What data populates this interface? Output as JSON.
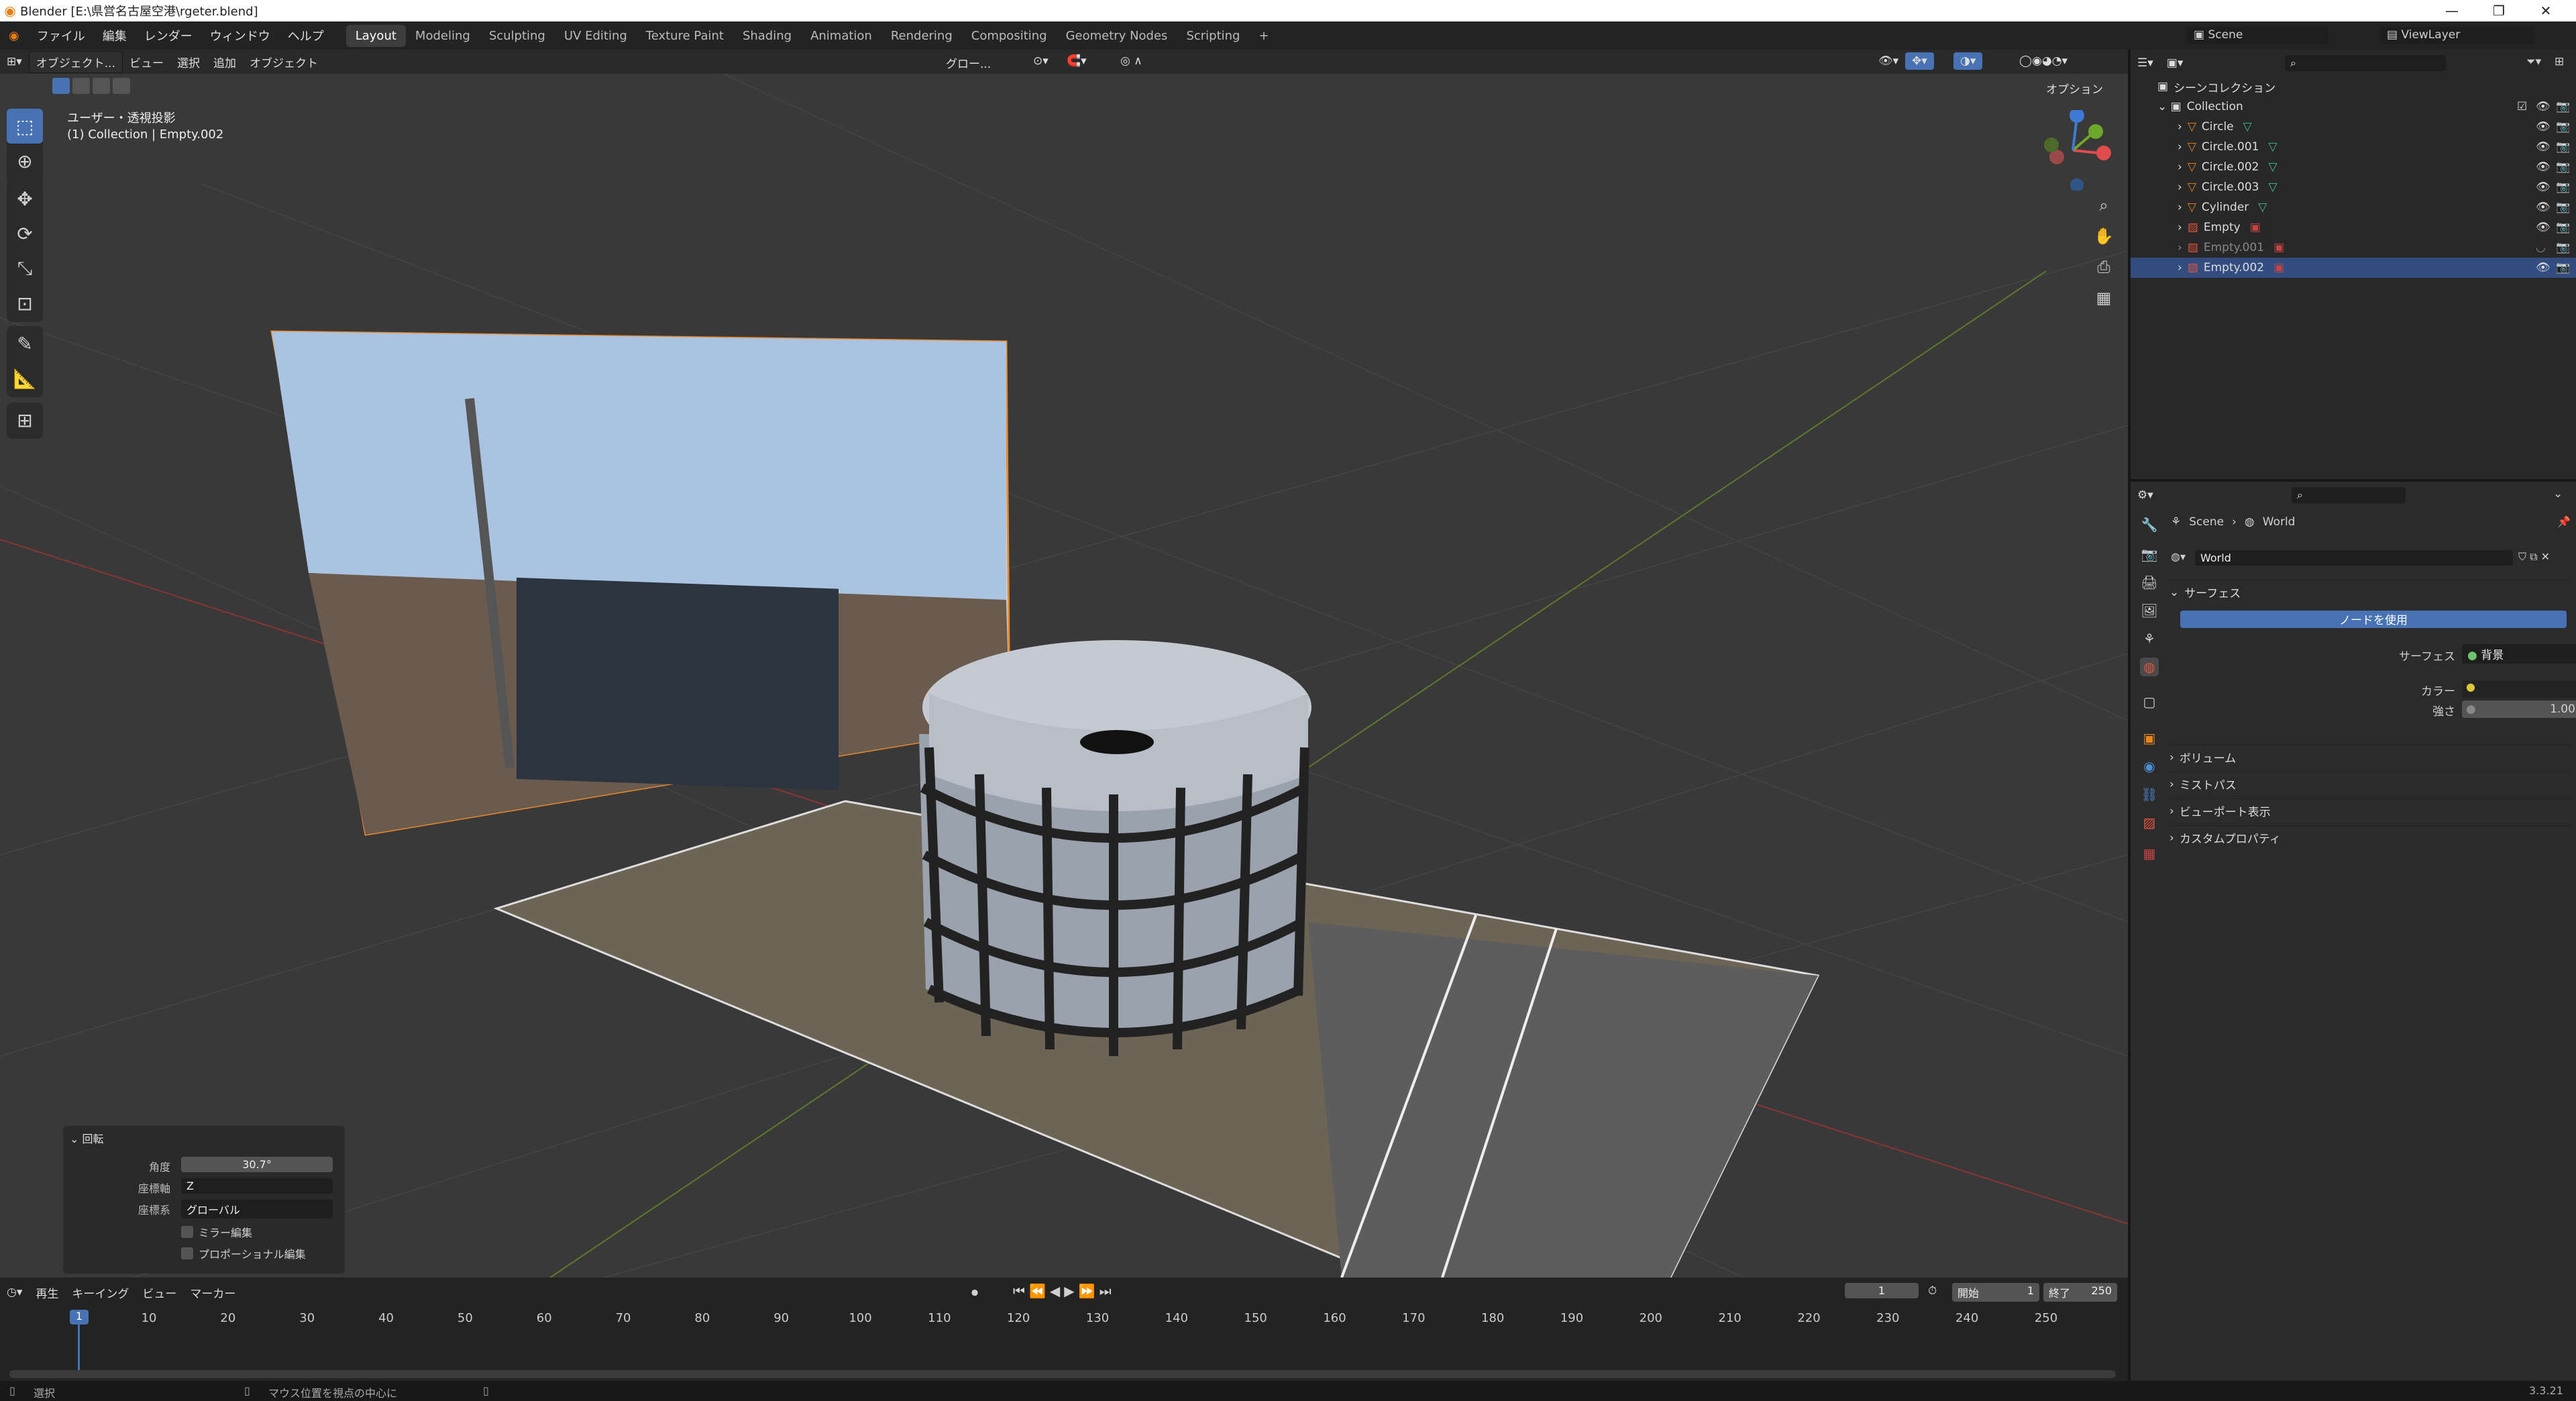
{
  "window": {
    "title": "Blender [E:\\県営名古屋空港\\rgeter.blend]"
  },
  "menus": [
    "ファイル",
    "編集",
    "レンダー",
    "ウィンドウ",
    "ヘルプ"
  ],
  "workspaces": [
    {
      "label": "Layout",
      "active": true
    },
    {
      "label": "Modeling"
    },
    {
      "label": "Sculpting"
    },
    {
      "label": "UV Editing"
    },
    {
      "label": "Texture Paint"
    },
    {
      "label": "Shading"
    },
    {
      "label": "Animation"
    },
    {
      "label": "Rendering"
    },
    {
      "label": "Compositing"
    },
    {
      "label": "Geometry Nodes"
    },
    {
      "label": "Scripting"
    }
  ],
  "scene": {
    "name": "Scene",
    "view_layer": "ViewLayer"
  },
  "viewport": {
    "mode": "オブジェクト...",
    "menus": [
      "ビュー",
      "選択",
      "追加",
      "オブジェクト"
    ],
    "transform": "グロー...",
    "options": "オプション",
    "info_line1": "ユーザー・透視投影",
    "info_line2": "(1) Collection | Empty.002"
  },
  "redo_panel": {
    "title": "回転",
    "angle_label": "角度",
    "angle_value": "30.7°",
    "axis_label": "座標軸",
    "axis_value": "Z",
    "orient_label": "座標系",
    "orient_value": "グローバル",
    "mirror": "ミラー編集",
    "proportional": "プロポーショナル編集"
  },
  "outliner": {
    "root": "シーンコレクション",
    "collection": "Collection",
    "items": [
      {
        "name": "Circle",
        "type": "mesh",
        "selected": false,
        "dim": false
      },
      {
        "name": "Circle.001",
        "type": "mesh",
        "selected": false,
        "dim": false
      },
      {
        "name": "Circle.002",
        "type": "mesh",
        "selected": false,
        "dim": false
      },
      {
        "name": "Circle.003",
        "type": "mesh",
        "selected": false,
        "dim": false
      },
      {
        "name": "Cylinder",
        "type": "mesh",
        "selected": false,
        "dim": false
      },
      {
        "name": "Empty",
        "type": "image",
        "selected": false,
        "dim": false
      },
      {
        "name": "Empty.001",
        "type": "image",
        "selected": false,
        "dim": true
      },
      {
        "name": "Empty.002",
        "type": "image",
        "selected": true,
        "dim": false
      }
    ]
  },
  "properties": {
    "breadcrumb_scene": "Scene",
    "breadcrumb_world": "World",
    "world_name": "World",
    "surface_section": "サーフェス",
    "use_nodes": "ノードを使用",
    "surface_label": "サーフェス",
    "surface_value": "背景",
    "color_label": "カラー",
    "strength_label": "強さ",
    "strength_value": "1.000",
    "sections": [
      "ボリューム",
      "ミストパス",
      "ビューポート表示",
      "カスタムプロパティ"
    ]
  },
  "timeline": {
    "menus": [
      "再生",
      "キーイング",
      "ビュー",
      "マーカー"
    ],
    "current_frame": "1",
    "start_label": "開始",
    "start": "1",
    "end_label": "終了",
    "end": "250",
    "ticks": [
      "1",
      "10",
      "20",
      "30",
      "40",
      "50",
      "60",
      "70",
      "80",
      "90",
      "100",
      "110",
      "120",
      "130",
      "140",
      "150",
      "160",
      "170",
      "180",
      "190",
      "200",
      "210",
      "220",
      "230",
      "240",
      "250"
    ]
  },
  "status": {
    "left": "選択",
    "mid": "マウス位置を視点の中心に",
    "version": "3.3.21"
  },
  "colors": {
    "accent": "#4772b3",
    "selection": "#334d80",
    "world_icon": "#e0543e"
  }
}
